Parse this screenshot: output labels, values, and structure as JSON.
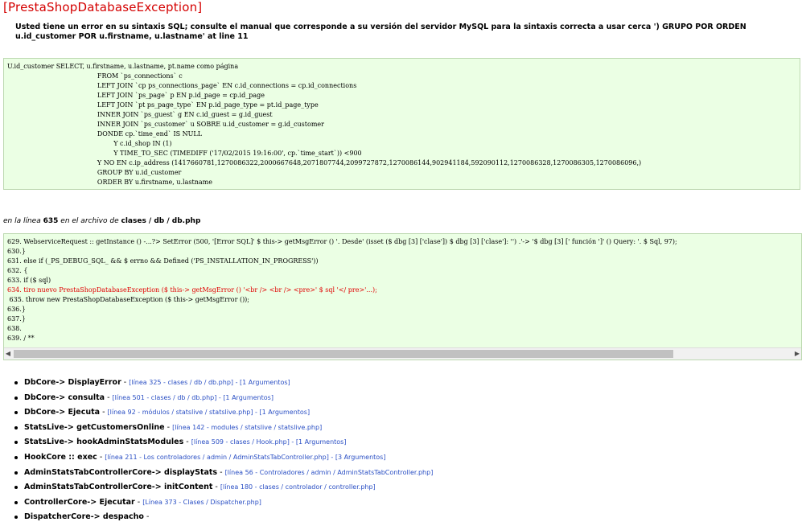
{
  "exception_title": "[PrestaShopDatabaseException]",
  "error_message": "Usted tiene un error en su sintaxis SQL; consulte el manual que corresponde a su versión del servidor MySQL para la sintaxis correcta a usar cerca ') GRUPO POR ORDEN u.id_customer POR u.firstname, u.lastname' at line 11",
  "sql_lines": [
    "U.id_customer SELECT, u.firstname, u.lastname, pt.name como página",
    "                                            FROM `ps_connections` c",
    "                                            LEFT JOIN `cp ps_connections_page` EN c.id_connections = cp.id_connections",
    "                                            LEFT JOIN `ps_page` p EN p.id_page = cp.id_page",
    "                                            LEFT JOIN `pt ps_page_type` EN p.id_page_type = pt.id_page_type",
    "                                            INNER JOIN `ps_guest` g EN c.id_guest = g.id_guest",
    "                                            INNER JOIN `ps_customer` u SOBRE u.id_customer = g.id_customer",
    "                                            DONDE cp.`time_end` IS NULL",
    "                                                    Y c.id_shop IN (1)",
    "                                                    Y TIME_TO_SEC (TIMEDIFF ('17/02/2015 19:16:00', cp.`time_start`)) <900",
    "                                            Y NO EN c.ip_address (1417660781,1270086322,2000667648,2071807744,2099727872,1270086144,902941184,592090112,1270086328,1270086305,1270086096,)",
    "                                            GROUP BY u.id_customer",
    "                                            ORDER BY u.firstname, u.lastname"
  ],
  "file_info": {
    "prefix": "en la línea",
    "line": "635",
    "middle": "en el archivo de",
    "path": "clases / db / db.php"
  },
  "code_lines": [
    {
      "text": "629. WebserviceRequest :: getInstance () -...?> SetError (500, '[Error SQL]' $ this-> getMsgError () '. Desde' (isset ($ dbg [3] ['clase']) $ dbg [3] ['clase']: '') .'-> '$ dbg [3] [' función ']' () Query: '. $ Sql, 97);",
      "highlight": false
    },
    {
      "text": "630.}",
      "highlight": false
    },
    {
      "text": "631. else if (_PS_DEBUG_SQL_ && $ errno && Defined ('PS_INSTALLATION_IN_PROGRESS'))",
      "highlight": false
    },
    {
      "text": "632. {",
      "highlight": false
    },
    {
      "text": "633. if ($ sql)",
      "highlight": false
    },
    {
      "text": "634. tiro nuevo PrestaShopDatabaseException ($ this-> getMsgError () '<br /> <br /> <pre>' $ sql '</ pre>'...);",
      "highlight": true
    },
    {
      "text": " 635. throw new PrestaShopDatabaseException ($ this-> getMsgError ());",
      "highlight": false
    },
    {
      "text": "636.}",
      "highlight": false
    },
    {
      "text": "637.}",
      "highlight": false
    },
    {
      "text": "638.",
      "highlight": false
    },
    {
      "text": "639. / **",
      "highlight": false
    }
  ],
  "stack_trace": [
    {
      "fn": "DbCore-> DisplayError",
      "sep": " - ",
      "ref": "[línea 325 - clases / db / db.php] - [1 Argumentos]"
    },
    {
      "fn": "DbCore-> consulta",
      "sep": " - ",
      "ref": "[línea 501 - clases / db / db.php] - [1 Argumentos]"
    },
    {
      "fn": "DbCore-> Ejecuta",
      "sep": " - ",
      "ref": "[línea 92 - módulos / statslive / statslive.php] - [1 Argumentos]"
    },
    {
      "fn": "StatsLive-> getCustomersOnline",
      "sep": " - ",
      "ref": "[línea 142 - modules / statslive / statslive.php]"
    },
    {
      "fn": "StatsLive-> hookAdminStatsModules",
      "sep": " - ",
      "ref": "[línea 509 - clases / Hook.php] - [1 Argumentos]"
    },
    {
      "fn": "HookCore :: exec",
      "sep": " - ",
      "ref": "[línea 211 - Los controladores / admin / AdminStatsTabController.php] - [3 Argumentos]"
    },
    {
      "fn": "AdminStatsTabControllerCore-> displayStats",
      "sep": " - ",
      "ref": "[línea 56 - Controladores / admin / AdminStatsTabController.php]"
    },
    {
      "fn": "AdminStatsTabControllerCore-> initContent",
      "sep": " - ",
      "ref": "[línea 180 - clases / controlador / controller.php]"
    },
    {
      "fn": "ControllerCore-> Ejecutar",
      "sep": " - ",
      "ref": "[Línea 373 - Clases / Dispatcher.php]"
    },
    {
      "fn": "DispatcherCore-> despacho",
      "sep": " - ",
      "ref": ""
    }
  ],
  "colors": {
    "title": "#d40000",
    "box_bg": "#ebffe4",
    "highlight": "#e00000",
    "link": "#2a4fc4"
  }
}
